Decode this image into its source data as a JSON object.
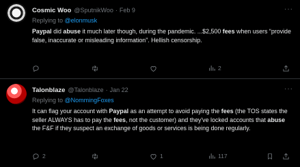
{
  "tweets": [
    {
      "name": "Cosmic Woo",
      "handle": "@SputnikWoo",
      "separator": "·",
      "date": "Feb 9",
      "more": "···",
      "replying_prefix": "Replying to ",
      "replying_to": "@elonmusk",
      "body": [
        {
          "t": "Paypal",
          "b": true
        },
        {
          "t": " did ",
          "b": false
        },
        {
          "t": "abuse",
          "b": true
        },
        {
          "t": " it much later though, during the pandemic. ...$2,500 ",
          "b": false
        },
        {
          "t": "fees",
          "b": true
        },
        {
          "t": " when users “provide false, inaccurate or misleading information”.  Hellish censorship.",
          "b": false
        }
      ],
      "actions": {
        "reply": "",
        "retweet": "",
        "like": "",
        "views": "2"
      }
    },
    {
      "name": "Talonblaze",
      "handle": "@Talonblaze",
      "separator": "·",
      "date": "Jan 22",
      "more": "···",
      "replying_prefix": "Replying to ",
      "replying_to": "@NommingFoxes",
      "body": [
        {
          "t": "It can flag your account with ",
          "b": false
        },
        {
          "t": "Paypal",
          "b": true
        },
        {
          "t": " as an attempt to avoid paying the ",
          "b": false
        },
        {
          "t": "fees",
          "b": true
        },
        {
          "t": " (the TOS states the seller ALWAYS has to pay the ",
          "b": false
        },
        {
          "t": "fees",
          "b": true
        },
        {
          "t": ", not the customer) and they've locked accounts that ",
          "b": false
        },
        {
          "t": "abuse",
          "b": true
        },
        {
          "t": " the F&F if they suspect an exchange of goods or services is being done regularly.",
          "b": false
        }
      ],
      "actions": {
        "reply": "2",
        "retweet": "",
        "like": "1",
        "views": "117"
      }
    }
  ]
}
